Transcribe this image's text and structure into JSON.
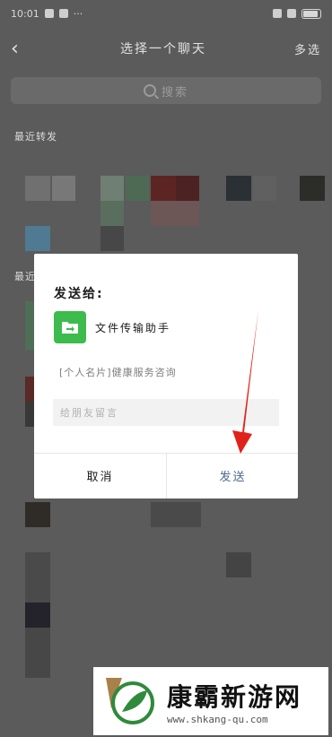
{
  "statusbar": {
    "time": "10:01",
    "battery": "100"
  },
  "nav": {
    "title": "选择一个聊天",
    "multi_select": "多选"
  },
  "search": {
    "placeholder": "搜索"
  },
  "sections": {
    "recent_forward": "最近转发",
    "recent_chats": "最近"
  },
  "dialog": {
    "title": "发送给:",
    "contact_name": "文件传输助手",
    "card_text": "[个人名片]健康服务咨询",
    "message_placeholder": "给朋友留言",
    "cancel_label": "取消",
    "send_label": "发送"
  },
  "watermark": {
    "site_name": "康霸新游网",
    "url": "www.shkang-qu.com"
  },
  "colors": {
    "accent_green": "#3dbb4d",
    "send_blue": "#4c6891",
    "annotation_red": "#e0221b"
  }
}
